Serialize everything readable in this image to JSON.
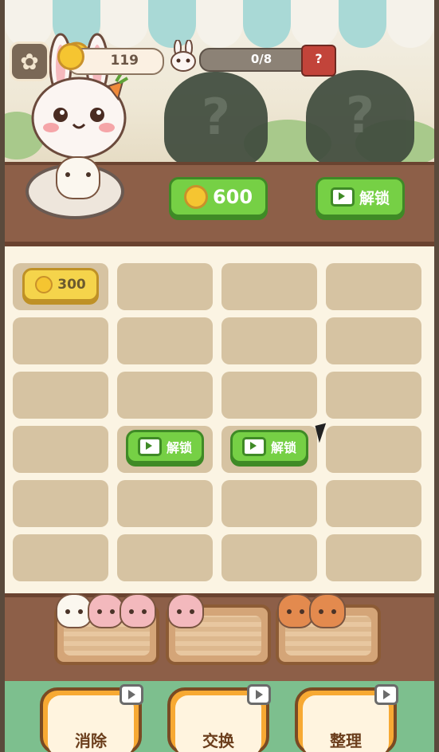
{
  "top_bar": {
    "coins": "119",
    "progress": "0/8",
    "progress_fraction": 0,
    "shop_mark": "?"
  },
  "scene": {
    "mystery_mark_1": "?",
    "mystery_mark_2": "?"
  },
  "counter": {
    "price_button": "600",
    "unlock_button": "解锁"
  },
  "grid": {
    "rows": 6,
    "cols": 4,
    "coin_cell": {
      "row": 1,
      "col": 1,
      "value": "300"
    },
    "unlock_cells": [
      {
        "row": 4,
        "col": 2,
        "label": "解锁"
      },
      {
        "row": 4,
        "col": 3,
        "label": "解锁"
      }
    ]
  },
  "trays": [
    {
      "pieces": [
        "pig",
        "bunny",
        "bunny"
      ]
    },
    {
      "pieces": [
        "bunny"
      ]
    },
    {
      "pieces": [
        "capybara",
        "capybara"
      ]
    }
  ],
  "tools": [
    {
      "label": "消除",
      "icon": "remove-pig-icon"
    },
    {
      "label": "交换",
      "icon": "swap-arrows-icon"
    },
    {
      "label": "整理",
      "icon": "steamer-icon"
    }
  ],
  "colors": {
    "green": "#76d045",
    "gold": "#f5c531",
    "wood": "#8d5f48",
    "cell": "#d6c3a2"
  }
}
